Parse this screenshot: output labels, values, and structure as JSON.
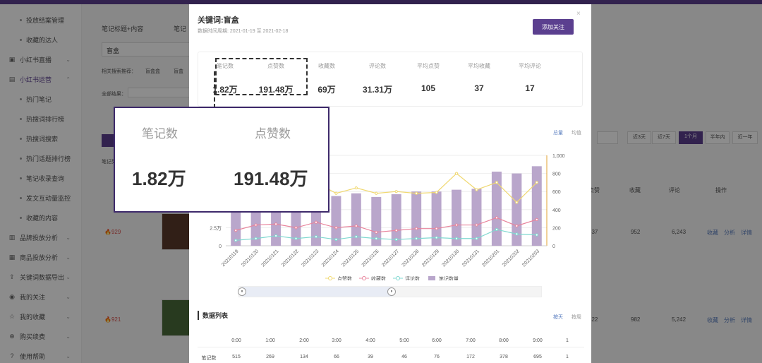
{
  "sidebar": {
    "items": [
      {
        "label": "投放结案管理",
        "type": "sub",
        "top": 12
      },
      {
        "label": "收藏的达人",
        "type": "sub",
        "top": 40
      },
      {
        "label": "小红书直播",
        "type": "group",
        "icon": "video-icon",
        "top": 68
      },
      {
        "label": "小红书运营",
        "type": "group",
        "icon": "book-icon",
        "top": 96,
        "active": true
      },
      {
        "label": "热门笔记",
        "type": "sub",
        "top": 124
      },
      {
        "label": "热搜词排行榜",
        "type": "sub",
        "top": 152
      },
      {
        "label": "热搜词搜索",
        "type": "sub",
        "top": 180
      },
      {
        "label": "热门话题排行榜",
        "type": "sub",
        "top": 208
      },
      {
        "label": "笔记收录查询",
        "type": "sub",
        "top": 236
      },
      {
        "label": "发文互动量监控",
        "type": "sub",
        "top": 264
      },
      {
        "label": "收藏的内容",
        "type": "sub",
        "top": 292
      },
      {
        "label": "品牌投放分析",
        "type": "group",
        "icon": "chart-icon",
        "top": 320
      },
      {
        "label": "商品投放分析",
        "type": "group",
        "icon": "box-icon",
        "top": 348
      },
      {
        "label": "关键词数据导出",
        "type": "group",
        "icon": "export-icon",
        "top": 376
      },
      {
        "label": "我的关注",
        "type": "group",
        "icon": "eye-icon",
        "top": 404
      },
      {
        "label": "我的收藏",
        "type": "group",
        "icon": "star-icon",
        "top": 432
      },
      {
        "label": "购买续费",
        "type": "group",
        "icon": "cart-icon",
        "top": 460
      },
      {
        "label": "使用帮助",
        "type": "group",
        "icon": "help-icon",
        "top": 488
      }
    ]
  },
  "background": {
    "tab_label": "笔记标题+内容",
    "tab2": "笔记",
    "search_value": "盲盒",
    "related_label": "相关搜索推荐：",
    "related_1": "盲盒盒",
    "related_2": "盲盒",
    "filter_label": "全部结果：",
    "periods": [
      "近3天",
      "近7天",
      "1个月",
      "半年内",
      "近一年"
    ],
    "active_period": "1个月",
    "columns": [
      "点赞",
      "收藏",
      "评论",
      "操作"
    ],
    "rows": [
      {
        "rank": "929",
        "likes": "537",
        "fav": "952",
        "comments": "6,243"
      },
      {
        "rank": "921",
        "likes": "422",
        "fav": "982",
        "comments": "5,242"
      }
    ],
    "actions": [
      "收藏",
      "分析",
      "详情"
    ],
    "note_list_label": "笔记列表"
  },
  "modal": {
    "title": "关键词:盲盒",
    "subtitle": "数据时间周期: 2021-01-19 至 2021-02-18",
    "follow_label": "添加关注",
    "close": "×",
    "stats": [
      {
        "label": "笔记数",
        "value": "1.82万"
      },
      {
        "label": "点赞数",
        "value": "191.48万"
      },
      {
        "label": "收藏数",
        "value": "69万"
      },
      {
        "label": "评论数",
        "value": "31.31万"
      },
      {
        "label": "平均点赞",
        "value": "105"
      },
      {
        "label": "平均收藏",
        "value": "37"
      },
      {
        "label": "平均评论",
        "value": "17"
      }
    ],
    "chart_tab_total": "总量",
    "chart_tab_avg": "均值",
    "list_title": "数据列表",
    "list_tab_day": "按天",
    "list_tab_week": "按周"
  },
  "chart_data": {
    "type": "bar",
    "categories": [
      "20210119",
      "20210120",
      "20210121",
      "20210122",
      "20210123",
      "20210124",
      "20210125",
      "20210126",
      "20210127",
      "20210128",
      "20210129",
      "20210130",
      "20210131",
      "20210201",
      "20210202",
      "20210203"
    ],
    "left_ticks": [
      "0",
      "2.5万",
      "5万"
    ],
    "right_ticks": [
      "0",
      "200",
      "400",
      "600",
      "800",
      "1,000"
    ],
    "right_ylim": [
      0,
      1000
    ],
    "series": [
      {
        "name": "点赞数",
        "kind": "line",
        "color": "#f0d870",
        "values": [
          620,
          720,
          700,
          680,
          700,
          580,
          640,
          580,
          600,
          580,
          590,
          800,
          620,
          700,
          480,
          700
        ]
      },
      {
        "name": "收藏数",
        "kind": "line",
        "color": "#e8849c",
        "values": [
          170,
          230,
          240,
          200,
          260,
          200,
          220,
          150,
          170,
          190,
          190,
          230,
          230,
          310,
          220,
          290
        ]
      },
      {
        "name": "评论数",
        "kind": "line",
        "color": "#7fd8d0",
        "values": [
          60,
          80,
          110,
          80,
          100,
          70,
          100,
          80,
          70,
          80,
          90,
          80,
          80,
          180,
          130,
          120
        ]
      },
      {
        "name": "笔记数量",
        "kind": "bar",
        "color": "#b9a6cb",
        "values": [
          600,
          620,
          640,
          600,
          560,
          550,
          580,
          540,
          570,
          600,
          600,
          620,
          630,
          820,
          800,
          880
        ]
      }
    ]
  },
  "table": {
    "headers": [
      "0:00",
      "1:00",
      "2:00",
      "3:00",
      "4:00",
      "5:00",
      "6:00",
      "7:00",
      "8:00",
      "9:00",
      "1"
    ],
    "row_label": "笔记数",
    "values": [
      "515",
      "269",
      "134",
      "66",
      "39",
      "46",
      "76",
      "172",
      "378",
      "695",
      "1"
    ]
  },
  "zoom": {
    "labels": [
      "笔记数",
      "点赞数"
    ],
    "values": [
      "1.82万",
      "191.48万"
    ]
  }
}
